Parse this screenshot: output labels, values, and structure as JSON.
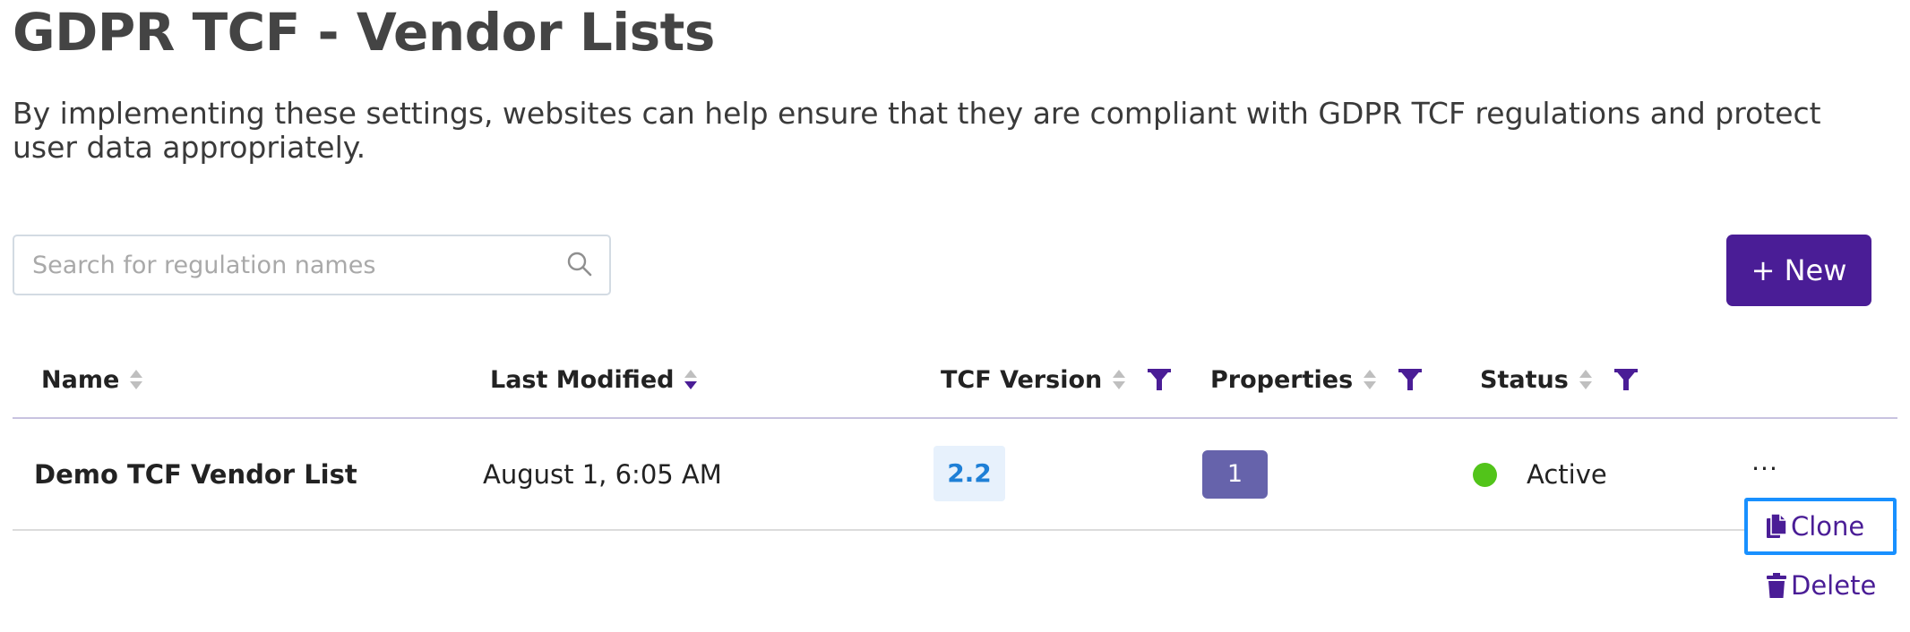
{
  "page": {
    "title": "GDPR TCF - Vendor Lists",
    "description": "By implementing these settings, websites can help ensure that they are compliant with GDPR TCF regulations and protect user data appropriately."
  },
  "search": {
    "placeholder": "Search for regulation names",
    "value": "",
    "icon": "search-icon"
  },
  "toolbar": {
    "new_label": "+ New"
  },
  "table": {
    "columns": {
      "name": "Name",
      "last_modified": "Last Modified",
      "tcf_version": "TCF Version",
      "properties": "Properties",
      "status": "Status"
    },
    "rows": [
      {
        "name": "Demo TCF Vendor List",
        "last_modified": "August 1, 6:05 AM",
        "tcf_version": "2.2",
        "properties": "1",
        "status": "Active"
      }
    ]
  },
  "row_menu": {
    "trigger": "...",
    "items": [
      {
        "label": "Clone",
        "icon": "copy-icon"
      },
      {
        "label": "Delete",
        "icon": "trash-icon"
      }
    ]
  },
  "colors": {
    "brand": "#4a1d96",
    "status_active": "#52c41a",
    "version_badge_bg": "#e7f1fc",
    "version_badge_text": "#1e7fd6",
    "properties_badge_bg": "#6663ab",
    "focus_outline": "#1890ff"
  }
}
